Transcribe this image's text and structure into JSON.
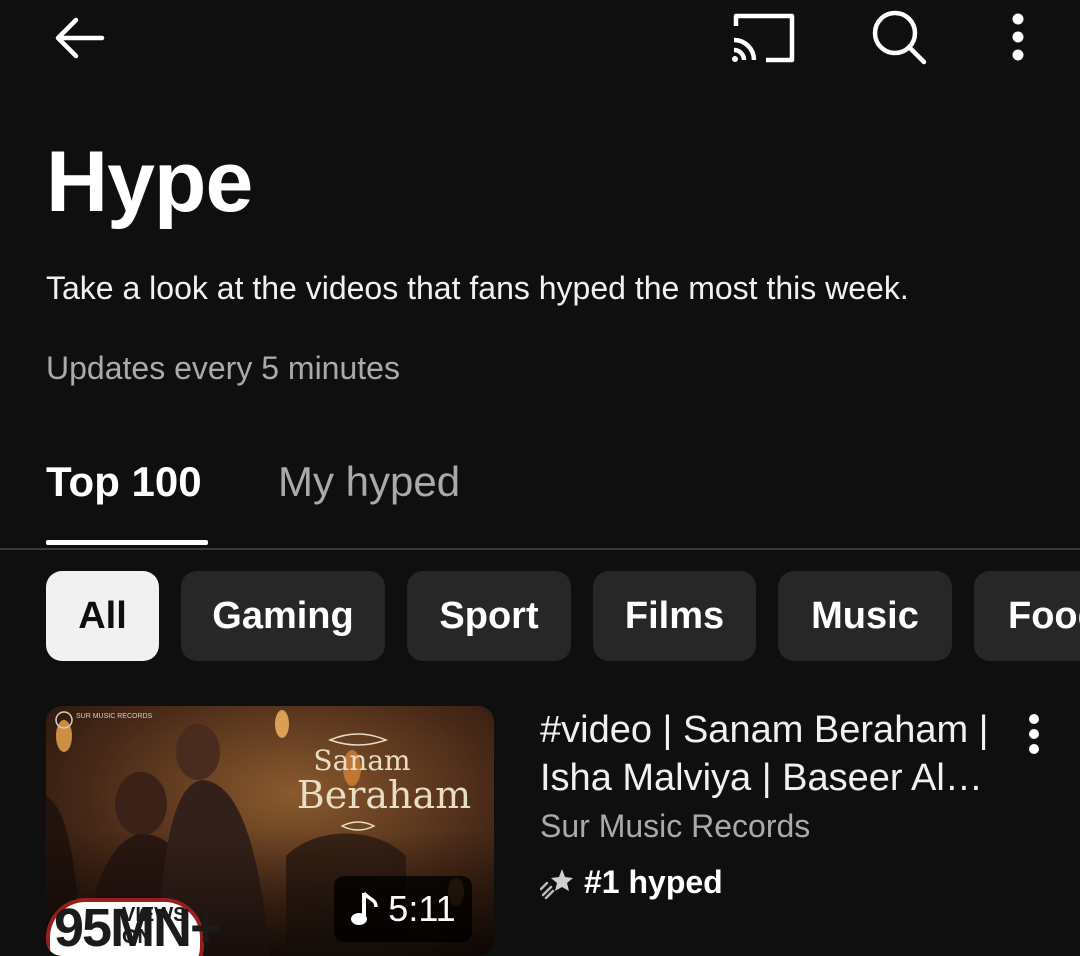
{
  "header": {
    "back_icon": "arrow-left-icon",
    "cast_icon": "cast-icon",
    "search_icon": "search-icon",
    "more_icon": "more-vertical-icon"
  },
  "page": {
    "title": "Hype",
    "description": "Take a look at the videos that fans hyped the most this week.",
    "updates": "Updates every 5 minutes"
  },
  "tabs": [
    {
      "label": "Top 100",
      "selected": true
    },
    {
      "label": "My hyped",
      "selected": false
    }
  ],
  "chips": [
    {
      "label": "All",
      "selected": true
    },
    {
      "label": "Gaming",
      "selected": false
    },
    {
      "label": "Sport",
      "selected": false
    },
    {
      "label": "Films",
      "selected": false
    },
    {
      "label": "Music",
      "selected": false
    },
    {
      "label": "Food",
      "selected": false
    }
  ],
  "video": {
    "title": "#video | Sanam Beraham | Isha Malviya | Baseer Al…",
    "channel": "Sur Music Records",
    "hype_rank": "#1 hyped",
    "duration": "5:11",
    "thumbnail": {
      "label_top": "SUR MUSIC RECORDS",
      "song_line1": "Sanam",
      "song_line2": "Beraham",
      "badge_big": "95MN+",
      "badge_small": "VIEWS ON"
    },
    "colors": {
      "thumb_dark": "#2a1711",
      "thumb_warm": "#8a5a2e",
      "thumb_text": "#e9ddc4"
    }
  },
  "colors": {
    "background": "#0f0f0f",
    "chip_bg": "#272727",
    "chip_selected_bg": "#f1f1f1",
    "secondary_text": "#aaaaaa"
  }
}
